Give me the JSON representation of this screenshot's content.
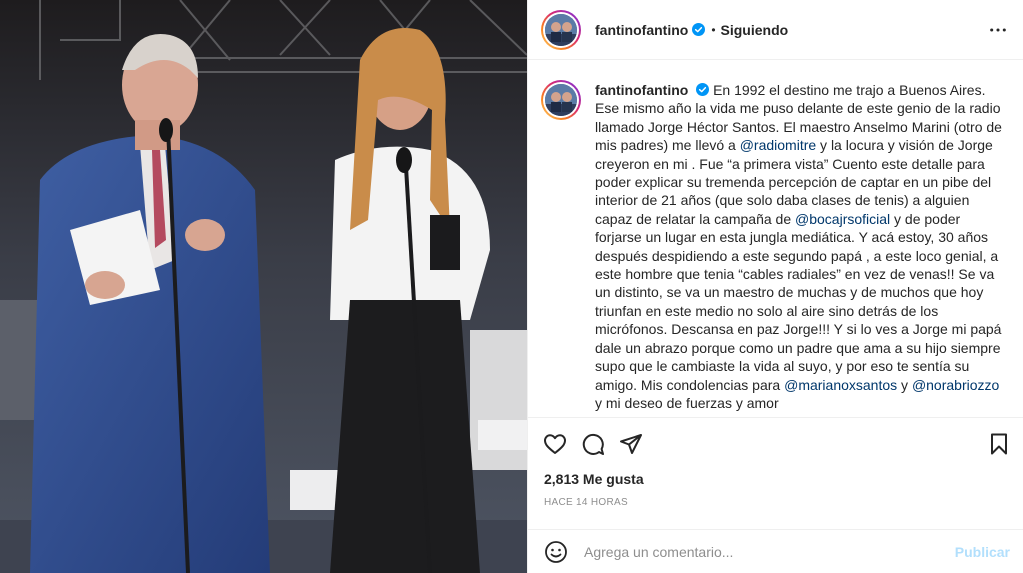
{
  "post": {
    "username": "fantinofantino",
    "separator": "•",
    "follow_status": "Siguiendo",
    "caption_segments": [
      {
        "text": "En 1992 el destino me trajo a Buenos Aires. Ese mismo año la vida me puso delante de este genio de la radio llamado Jorge Héctor Santos. El maestro Anselmo Marini (otro de mis padres) me llevó a ",
        "type": "text"
      },
      {
        "text": "@radiomitre",
        "type": "mention"
      },
      {
        "text": " y la locura y visión de Jorge creyeron en mi . Fue “a primera vista” Cuento este detalle para poder explicar su tremenda percepción de captar en un pibe del interior de 21 años (que solo daba clases de tenis) a alguien capaz de relatar la campaña de ",
        "type": "text"
      },
      {
        "text": "@bocajrsoficial",
        "type": "mention"
      },
      {
        "text": " y de poder forjarse un lugar en esta jungla mediática. Y acá estoy, 30 años después despidiendo a este segundo papá , a este loco genial, a este hombre que tenia “cables radiales” en vez de venas!! Se va un distinto, se va un maestro de muchas y de muchos que hoy triunfan en este medio no solo al aire sino detrás de los micrófonos. Descansa en paz Jorge!!! Y si lo ves a Jorge mi papá dale un abrazo porque como un padre que ama a su hijo siempre supo que le cambiaste la vida al suyo, y por eso te sentía su amigo. Mis condolencias para ",
        "type": "text"
      },
      {
        "text": "@marianoxsantos",
        "type": "mention"
      },
      {
        "text": " y ",
        "type": "text"
      },
      {
        "text": "@norabriozzo",
        "type": "mention"
      },
      {
        "text": " y mi deseo de fuerzas y amor",
        "type": "text"
      }
    ],
    "likes_label": "2,813 Me gusta",
    "time_label": "HACE 14 HORAS"
  },
  "comment": {
    "placeholder": "Agrega un comentario...",
    "publish_label": "Publicar"
  },
  "icons": {
    "verified": "verified-badge-icon",
    "more": "more-options-icon",
    "like": "heart-icon",
    "comment": "comment-icon",
    "share": "paper-plane-icon",
    "save": "bookmark-icon",
    "emoji": "emoji-icon"
  },
  "colors": {
    "verified_blue": "#0095f6",
    "mention": "#00376b",
    "muted": "#8e8e8e",
    "publish_disabled": "#b2dffc",
    "text": "#262626"
  }
}
